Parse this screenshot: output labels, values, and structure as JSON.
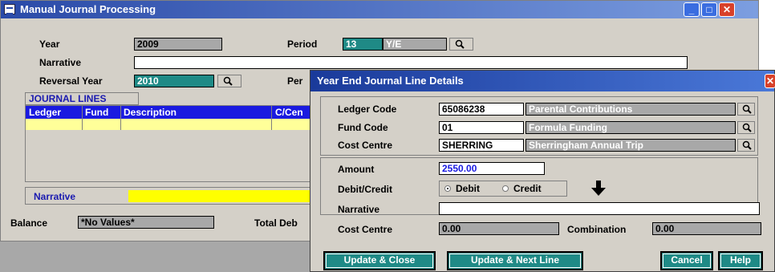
{
  "main": {
    "title": "Manual Journal Processing",
    "year_label": "Year",
    "year_value": "2009",
    "period_label": "Period",
    "period_num": "13",
    "period_name": "Y/E",
    "narrative_label": "Narrative",
    "narrative_value": "",
    "reversal_year_label": "Reversal Year",
    "reversal_year_value": "2010",
    "reversal_period_label_partial": "Per",
    "journal_lines_tab": "JOURNAL LINES",
    "grid_headers": [
      "Ledger",
      "Fund",
      "Description",
      "C/Cen"
    ],
    "line_narrative_label": "Narrative",
    "balance_label": "Balance",
    "balance_value": "*No Values*",
    "total_debit_label_partial": "Total Deb"
  },
  "dialog": {
    "title": "Year End Journal Line Details",
    "ledger_code_label": "Ledger Code",
    "ledger_code_value": "65086238",
    "ledger_code_desc": "Parental Contributions",
    "fund_code_label": "Fund Code",
    "fund_code_value": "01",
    "fund_code_desc": "Formula Funding",
    "cost_centre_label": "Cost Centre",
    "cost_centre_value": "SHERRING",
    "cost_centre_desc": "Sherringham Annual Trip",
    "amount_label": "Amount",
    "amount_value": "2550.00",
    "debit_credit_label": "Debit/Credit",
    "debit_option": "Debit",
    "credit_option": "Credit",
    "selected_option": "Debit",
    "narrative_label": "Narrative",
    "narrative_value": "",
    "cc_total_label": "Cost Centre",
    "cc_total_value": "0.00",
    "combination_label": "Combination",
    "combination_value": "0.00",
    "buttons": {
      "update_close": "Update & Close",
      "update_next": "Update & Next Line",
      "cancel": "Cancel",
      "help": "Help"
    }
  },
  "colors": {
    "title_bar": "#2a4aa8",
    "teal_button": "#1f8a86",
    "grid_header": "#1a1ae0",
    "grid_row": "#ffff99",
    "narrative_fill": "#ffff00",
    "amount_text": "#1a1ae0"
  }
}
